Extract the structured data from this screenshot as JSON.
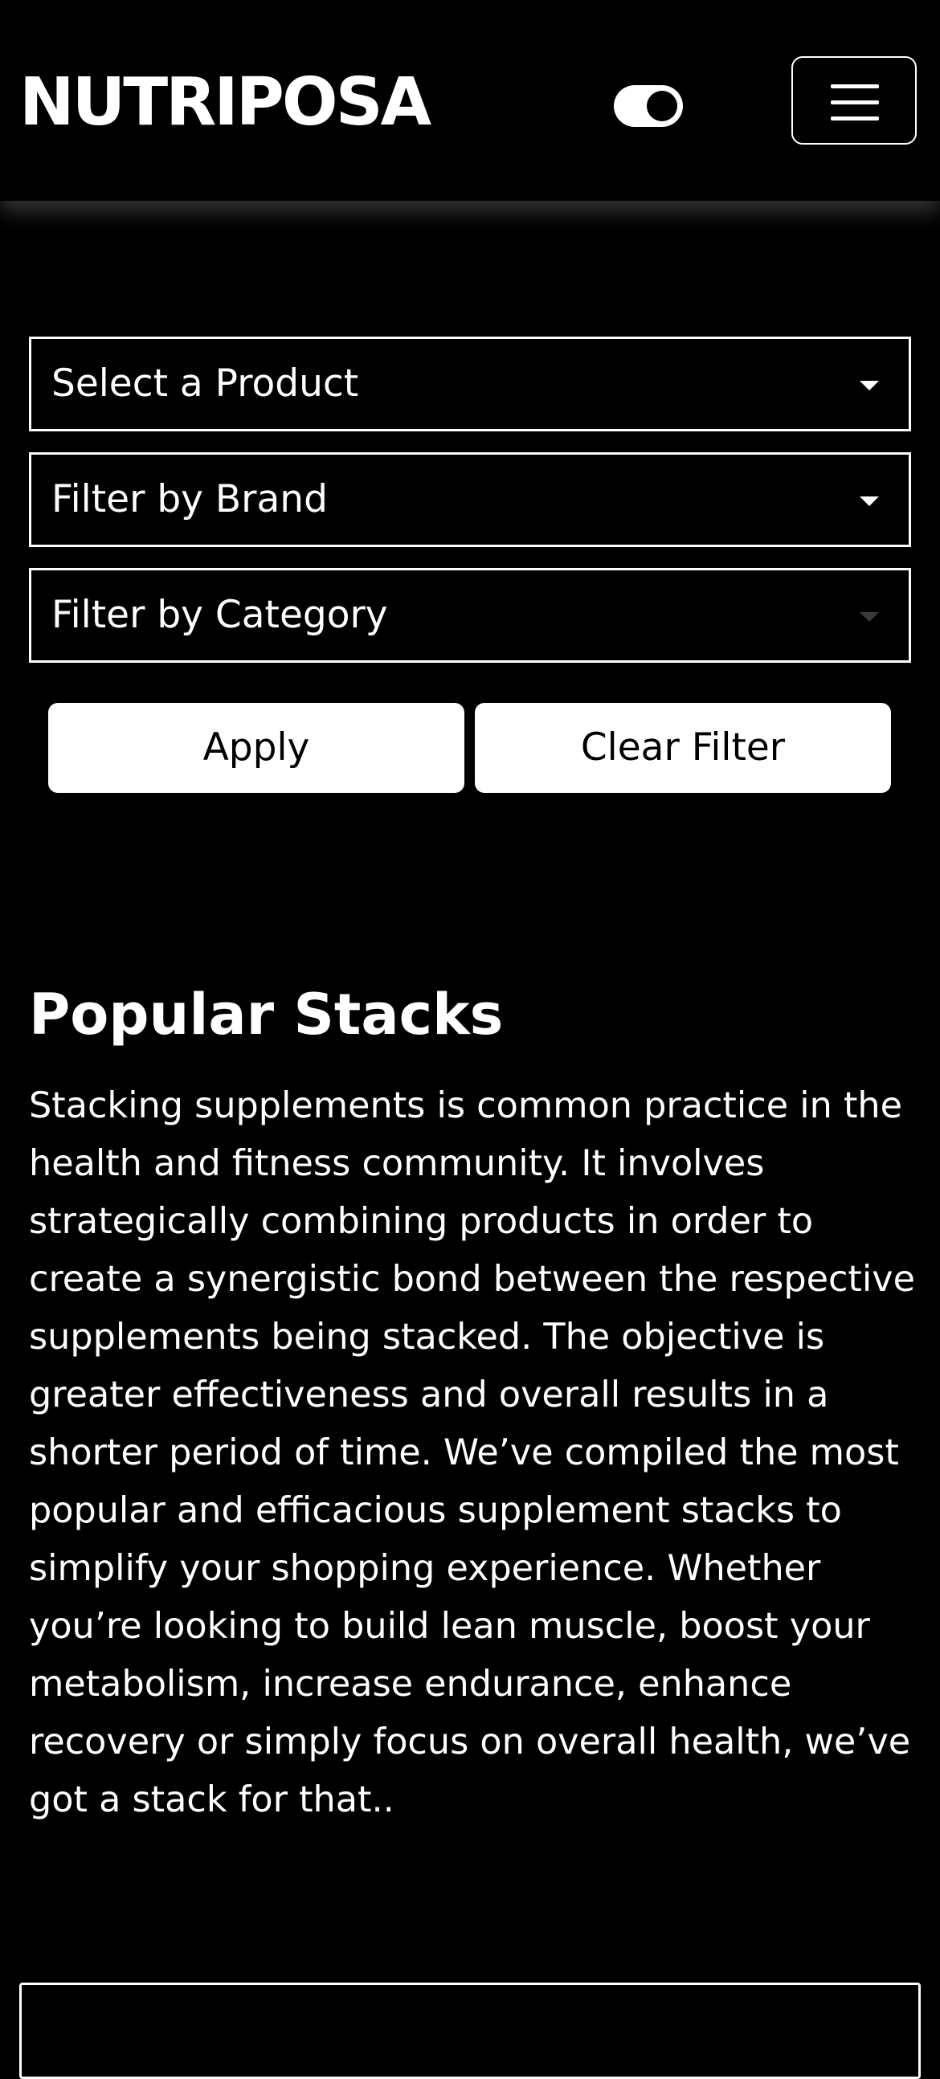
{
  "header": {
    "logo": "NUTRIPOSA",
    "theme_toggle_icon": "toggle-on-icon",
    "menu_icon": "hamburger-menu-icon"
  },
  "filters": {
    "product": {
      "selected": "Select a Product"
    },
    "brand": {
      "selected": "Filter by Brand"
    },
    "category": {
      "selected": "Filter by Category"
    },
    "apply_label": "Apply",
    "clear_label": "Clear Filter"
  },
  "popular_stacks": {
    "title": "Popular Stacks",
    "body": "Stacking supplements is common practice in the health and fitness community. It involves strategically combining products in order to create a synergistic bond between the respective supplements being stacked. The objective is greater effectiveness and overall results in a shorter period of time. We’ve compiled the most popular and efficacious supplement stacks to simplify your shopping experience. Whether you’re looking to build lean muscle, boost your metabolism, increase endurance, enhance recovery or simply focus on overall health, we’ve got a stack for that.."
  },
  "colors": {
    "background": "#000000",
    "foreground": "#ffffff",
    "disabled_caret": "#3a3a3a"
  }
}
